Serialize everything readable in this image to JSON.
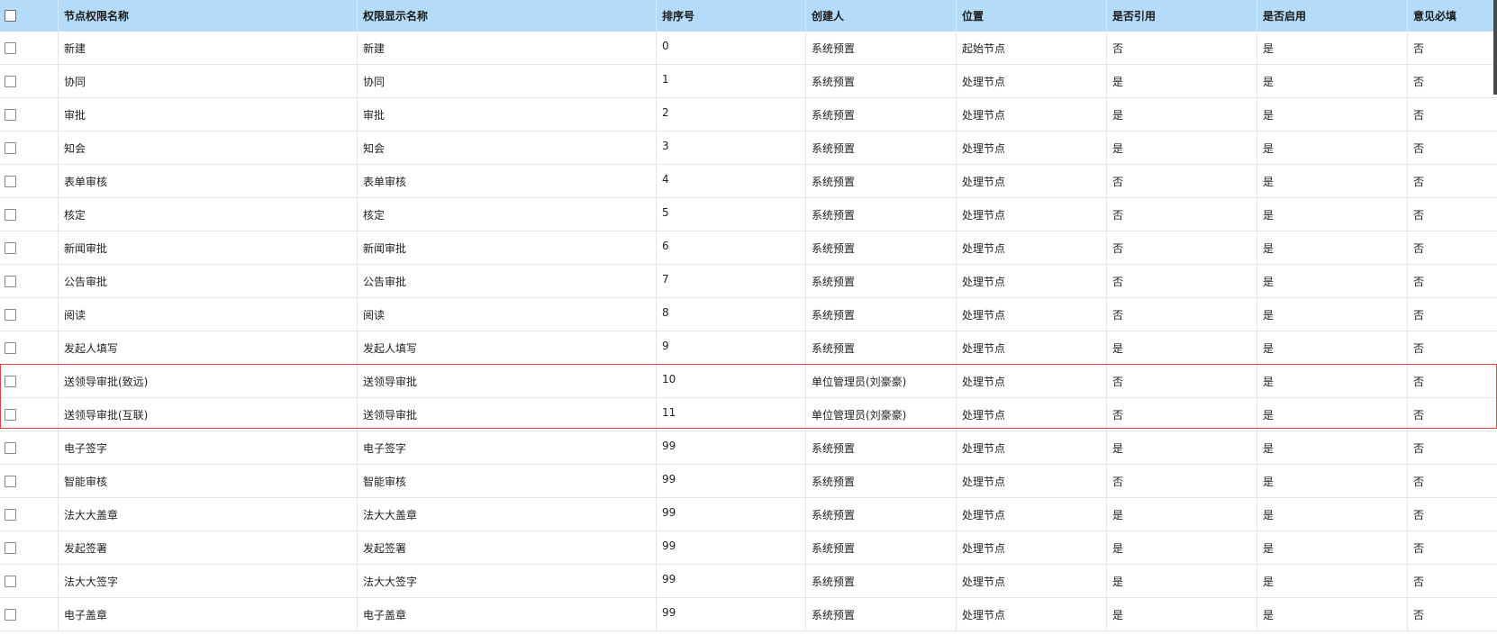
{
  "columns": [
    "节点权限名称",
    "权限显示名称",
    "排序号",
    "创建人",
    "位置",
    "是否引用",
    "是否启用",
    "意见必填"
  ],
  "rows": [
    {
      "name": "新建",
      "display": "新建",
      "order": "0",
      "creator": "系统预置",
      "position": "起始节点",
      "referenced": "否",
      "enabled": "是",
      "opinion_required": "否"
    },
    {
      "name": "协同",
      "display": "协同",
      "order": "1",
      "creator": "系统预置",
      "position": "处理节点",
      "referenced": "是",
      "enabled": "是",
      "opinion_required": "否"
    },
    {
      "name": "审批",
      "display": "审批",
      "order": "2",
      "creator": "系统预置",
      "position": "处理节点",
      "referenced": "是",
      "enabled": "是",
      "opinion_required": "否"
    },
    {
      "name": "知会",
      "display": "知会",
      "order": "3",
      "creator": "系统预置",
      "position": "处理节点",
      "referenced": "是",
      "enabled": "是",
      "opinion_required": "否"
    },
    {
      "name": "表单审核",
      "display": "表单审核",
      "order": "4",
      "creator": "系统预置",
      "position": "处理节点",
      "referenced": "否",
      "enabled": "是",
      "opinion_required": "否"
    },
    {
      "name": "核定",
      "display": "核定",
      "order": "5",
      "creator": "系统预置",
      "position": "处理节点",
      "referenced": "否",
      "enabled": "是",
      "opinion_required": "否"
    },
    {
      "name": "新闻审批",
      "display": "新闻审批",
      "order": "6",
      "creator": "系统预置",
      "position": "处理节点",
      "referenced": "否",
      "enabled": "是",
      "opinion_required": "否"
    },
    {
      "name": "公告审批",
      "display": "公告审批",
      "order": "7",
      "creator": "系统预置",
      "position": "处理节点",
      "referenced": "否",
      "enabled": "是",
      "opinion_required": "否"
    },
    {
      "name": "阅读",
      "display": "阅读",
      "order": "8",
      "creator": "系统预置",
      "position": "处理节点",
      "referenced": "否",
      "enabled": "是",
      "opinion_required": "否"
    },
    {
      "name": "发起人填写",
      "display": "发起人填写",
      "order": "9",
      "creator": "系统预置",
      "position": "处理节点",
      "referenced": "是",
      "enabled": "是",
      "opinion_required": "否"
    },
    {
      "name": "送领导审批(致远)",
      "display": "送领导审批",
      "order": "10",
      "creator": "单位管理员(刘豪豪)",
      "position": "处理节点",
      "referenced": "否",
      "enabled": "是",
      "opinion_required": "否"
    },
    {
      "name": "送领导审批(互联)",
      "display": "送领导审批",
      "order": "11",
      "creator": "单位管理员(刘豪豪)",
      "position": "处理节点",
      "referenced": "否",
      "enabled": "是",
      "opinion_required": "否"
    },
    {
      "name": "电子签字",
      "display": "电子签字",
      "order": "99",
      "creator": "系统预置",
      "position": "处理节点",
      "referenced": "是",
      "enabled": "是",
      "opinion_required": "否"
    },
    {
      "name": "智能审核",
      "display": "智能审核",
      "order": "99",
      "creator": "系统预置",
      "position": "处理节点",
      "referenced": "否",
      "enabled": "是",
      "opinion_required": "否"
    },
    {
      "name": "法大大盖章",
      "display": "法大大盖章",
      "order": "99",
      "creator": "系统预置",
      "position": "处理节点",
      "referenced": "是",
      "enabled": "是",
      "opinion_required": "否"
    },
    {
      "name": "发起签署",
      "display": "发起签署",
      "order": "99",
      "creator": "系统预置",
      "position": "处理节点",
      "referenced": "是",
      "enabled": "是",
      "opinion_required": "否"
    },
    {
      "name": "法大大签字",
      "display": "法大大签字",
      "order": "99",
      "creator": "系统预置",
      "position": "处理节点",
      "referenced": "是",
      "enabled": "是",
      "opinion_required": "否"
    },
    {
      "name": "电子盖章",
      "display": "电子盖章",
      "order": "99",
      "creator": "系统预置",
      "position": "处理节点",
      "referenced": "是",
      "enabled": "是",
      "opinion_required": "否"
    }
  ],
  "colors": {
    "header_bg": "#b4dcf8",
    "highlight_border": "#e04040",
    "row_border": "#e6e6e6"
  }
}
